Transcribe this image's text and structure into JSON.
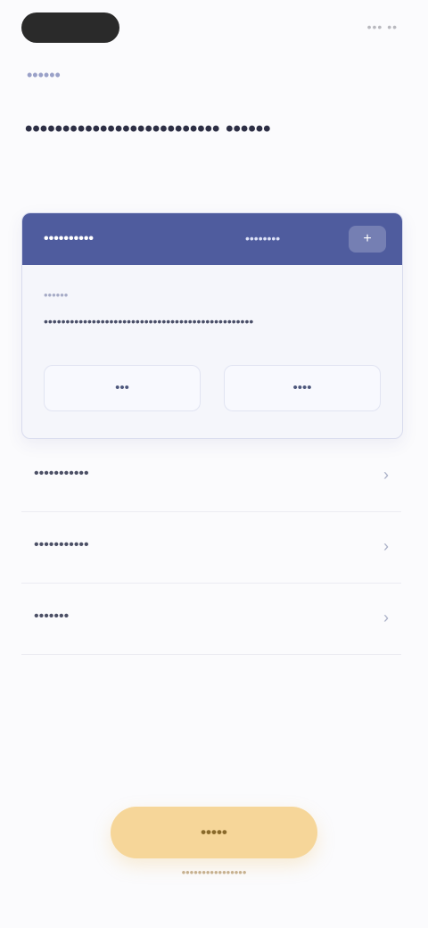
{
  "status": {
    "right_text": "••• ••"
  },
  "header": {
    "subtitle": "••••••",
    "headline": "•••••••••••••••••••••••••• ••••••"
  },
  "card": {
    "title": "••••••••••",
    "tag": "••••••••",
    "icon": "+",
    "label": "••••••",
    "body": "••••••••••••••••••••••••••••••••••••••••••••••••",
    "actions": [
      {
        "label": "•••"
      },
      {
        "label": "••••"
      }
    ]
  },
  "list": [
    {
      "label": "•••••••••••",
      "chevron": "›"
    },
    {
      "label": "•••••••••••",
      "chevron": "›"
    },
    {
      "label": "•••••••",
      "chevron": "›"
    }
  ],
  "footer": {
    "cta_label": "•••••",
    "note": "••••••••••••••••"
  }
}
